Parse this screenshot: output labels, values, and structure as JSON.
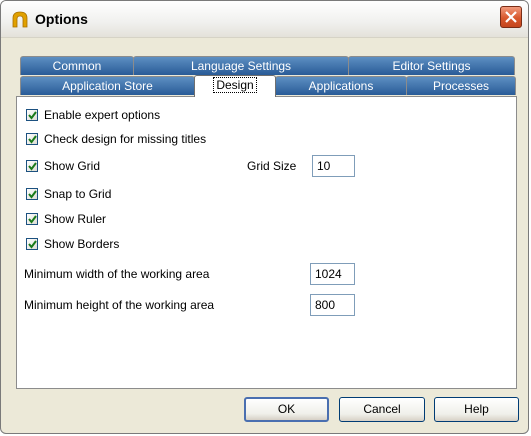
{
  "window": {
    "title": "Options",
    "accent": "#e0a000",
    "close_color": "#d8582d"
  },
  "tabs": {
    "row1": [
      "Common",
      "Language Settings",
      "Editor Settings"
    ],
    "row2": [
      "Application Store",
      "Design",
      "Applications",
      "Processes"
    ],
    "selected": "Design"
  },
  "design": {
    "enable_expert": "Enable expert options",
    "check_titles": "Check design for missing titles",
    "show_grid": "Show Grid",
    "grid_size_label": "Grid Size",
    "grid_size_value": "10",
    "snap_to_grid": "Snap to Grid",
    "show_ruler": "Show Ruler",
    "show_borders": "Show Borders",
    "min_width_label": "Minimum width of the working area",
    "min_width_value": "1024",
    "min_height_label": "Minimum height of the working area",
    "min_height_value": "800"
  },
  "checkbox_states": {
    "enable_expert": true,
    "check_titles": true,
    "show_grid": true,
    "snap_to_grid": true,
    "show_ruler": true,
    "show_borders": true
  },
  "buttons": {
    "ok": "OK",
    "cancel": "Cancel",
    "help": "Help"
  }
}
